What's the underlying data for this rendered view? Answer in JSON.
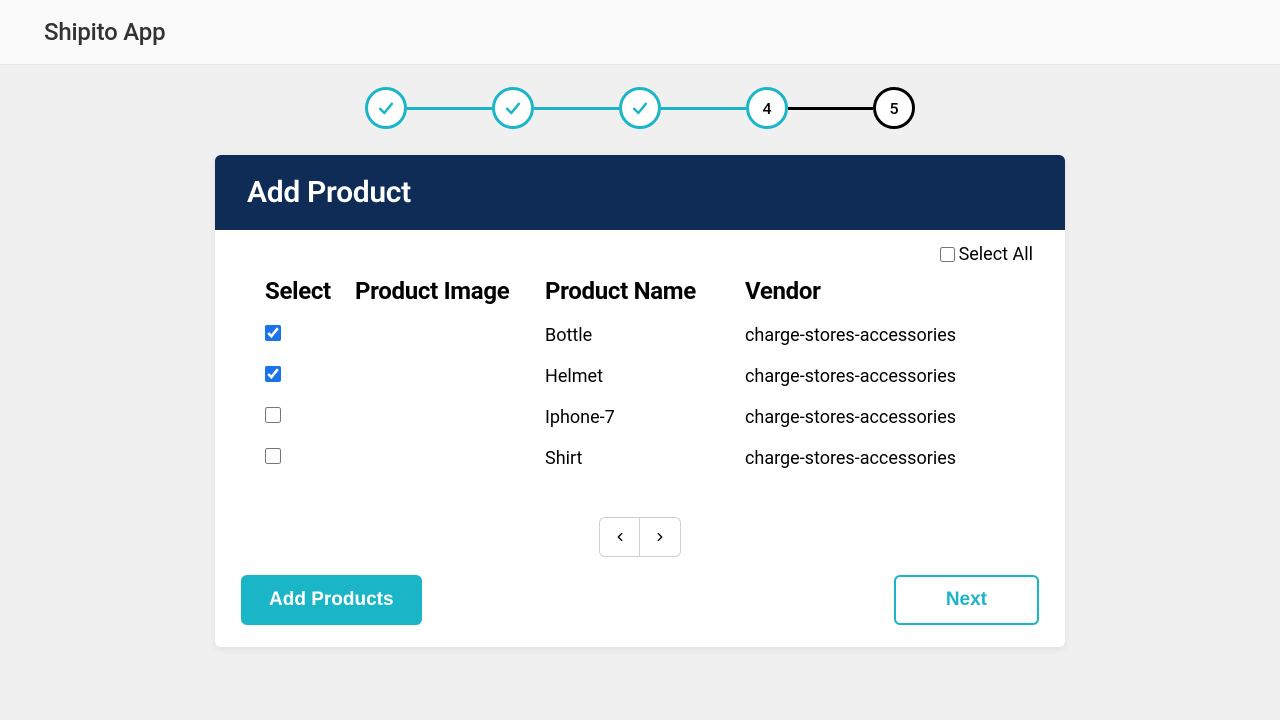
{
  "topbar": {
    "title": "Shipito App"
  },
  "stepper": {
    "steps": [
      {
        "state": "completed",
        "label": ""
      },
      {
        "state": "completed",
        "label": ""
      },
      {
        "state": "completed",
        "label": ""
      },
      {
        "state": "current",
        "label": "4"
      },
      {
        "state": "upcoming",
        "label": "5"
      }
    ]
  },
  "card": {
    "title": "Add Product",
    "select_all_label": "Select All",
    "select_all_checked": false,
    "columns": {
      "select": "Select",
      "image": "Product Image",
      "name": "Product Name",
      "vendor": "Vendor"
    },
    "rows": [
      {
        "checked": true,
        "name": "Bottle",
        "vendor": "charge-stores-accessories"
      },
      {
        "checked": true,
        "name": "Helmet",
        "vendor": "charge-stores-accessories"
      },
      {
        "checked": false,
        "name": "Iphone-7",
        "vendor": "charge-stores-accessories"
      },
      {
        "checked": false,
        "name": "Shirt",
        "vendor": "charge-stores-accessories"
      }
    ],
    "buttons": {
      "add": "Add Products",
      "next": "Next"
    }
  }
}
